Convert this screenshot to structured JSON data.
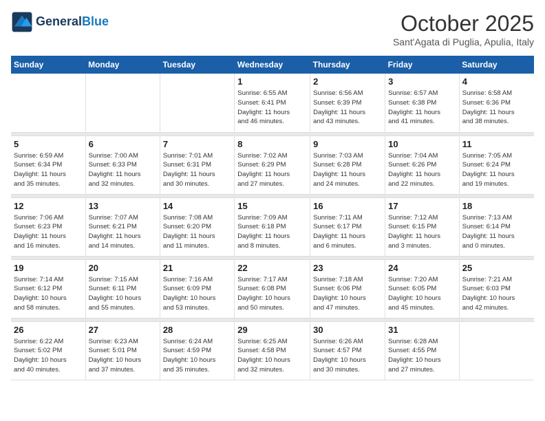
{
  "logo": {
    "line1": "General",
    "line2": "Blue"
  },
  "title": "October 2025",
  "location": "Sant'Agata di Puglia, Apulia, Italy",
  "days_of_week": [
    "Sunday",
    "Monday",
    "Tuesday",
    "Wednesday",
    "Thursday",
    "Friday",
    "Saturday"
  ],
  "weeks": [
    [
      {
        "day": "",
        "info": ""
      },
      {
        "day": "",
        "info": ""
      },
      {
        "day": "",
        "info": ""
      },
      {
        "day": "1",
        "info": "Sunrise: 6:55 AM\nSunset: 6:41 PM\nDaylight: 11 hours\nand 46 minutes."
      },
      {
        "day": "2",
        "info": "Sunrise: 6:56 AM\nSunset: 6:39 PM\nDaylight: 11 hours\nand 43 minutes."
      },
      {
        "day": "3",
        "info": "Sunrise: 6:57 AM\nSunset: 6:38 PM\nDaylight: 11 hours\nand 41 minutes."
      },
      {
        "day": "4",
        "info": "Sunrise: 6:58 AM\nSunset: 6:36 PM\nDaylight: 11 hours\nand 38 minutes."
      }
    ],
    [
      {
        "day": "5",
        "info": "Sunrise: 6:59 AM\nSunset: 6:34 PM\nDaylight: 11 hours\nand 35 minutes."
      },
      {
        "day": "6",
        "info": "Sunrise: 7:00 AM\nSunset: 6:33 PM\nDaylight: 11 hours\nand 32 minutes."
      },
      {
        "day": "7",
        "info": "Sunrise: 7:01 AM\nSunset: 6:31 PM\nDaylight: 11 hours\nand 30 minutes."
      },
      {
        "day": "8",
        "info": "Sunrise: 7:02 AM\nSunset: 6:29 PM\nDaylight: 11 hours\nand 27 minutes."
      },
      {
        "day": "9",
        "info": "Sunrise: 7:03 AM\nSunset: 6:28 PM\nDaylight: 11 hours\nand 24 minutes."
      },
      {
        "day": "10",
        "info": "Sunrise: 7:04 AM\nSunset: 6:26 PM\nDaylight: 11 hours\nand 22 minutes."
      },
      {
        "day": "11",
        "info": "Sunrise: 7:05 AM\nSunset: 6:24 PM\nDaylight: 11 hours\nand 19 minutes."
      }
    ],
    [
      {
        "day": "12",
        "info": "Sunrise: 7:06 AM\nSunset: 6:23 PM\nDaylight: 11 hours\nand 16 minutes."
      },
      {
        "day": "13",
        "info": "Sunrise: 7:07 AM\nSunset: 6:21 PM\nDaylight: 11 hours\nand 14 minutes."
      },
      {
        "day": "14",
        "info": "Sunrise: 7:08 AM\nSunset: 6:20 PM\nDaylight: 11 hours\nand 11 minutes."
      },
      {
        "day": "15",
        "info": "Sunrise: 7:09 AM\nSunset: 6:18 PM\nDaylight: 11 hours\nand 8 minutes."
      },
      {
        "day": "16",
        "info": "Sunrise: 7:11 AM\nSunset: 6:17 PM\nDaylight: 11 hours\nand 6 minutes."
      },
      {
        "day": "17",
        "info": "Sunrise: 7:12 AM\nSunset: 6:15 PM\nDaylight: 11 hours\nand 3 minutes."
      },
      {
        "day": "18",
        "info": "Sunrise: 7:13 AM\nSunset: 6:14 PM\nDaylight: 11 hours\nand 0 minutes."
      }
    ],
    [
      {
        "day": "19",
        "info": "Sunrise: 7:14 AM\nSunset: 6:12 PM\nDaylight: 10 hours\nand 58 minutes."
      },
      {
        "day": "20",
        "info": "Sunrise: 7:15 AM\nSunset: 6:11 PM\nDaylight: 10 hours\nand 55 minutes."
      },
      {
        "day": "21",
        "info": "Sunrise: 7:16 AM\nSunset: 6:09 PM\nDaylight: 10 hours\nand 53 minutes."
      },
      {
        "day": "22",
        "info": "Sunrise: 7:17 AM\nSunset: 6:08 PM\nDaylight: 10 hours\nand 50 minutes."
      },
      {
        "day": "23",
        "info": "Sunrise: 7:18 AM\nSunset: 6:06 PM\nDaylight: 10 hours\nand 47 minutes."
      },
      {
        "day": "24",
        "info": "Sunrise: 7:20 AM\nSunset: 6:05 PM\nDaylight: 10 hours\nand 45 minutes."
      },
      {
        "day": "25",
        "info": "Sunrise: 7:21 AM\nSunset: 6:03 PM\nDaylight: 10 hours\nand 42 minutes."
      }
    ],
    [
      {
        "day": "26",
        "info": "Sunrise: 6:22 AM\nSunset: 5:02 PM\nDaylight: 10 hours\nand 40 minutes."
      },
      {
        "day": "27",
        "info": "Sunrise: 6:23 AM\nSunset: 5:01 PM\nDaylight: 10 hours\nand 37 minutes."
      },
      {
        "day": "28",
        "info": "Sunrise: 6:24 AM\nSunset: 4:59 PM\nDaylight: 10 hours\nand 35 minutes."
      },
      {
        "day": "29",
        "info": "Sunrise: 6:25 AM\nSunset: 4:58 PM\nDaylight: 10 hours\nand 32 minutes."
      },
      {
        "day": "30",
        "info": "Sunrise: 6:26 AM\nSunset: 4:57 PM\nDaylight: 10 hours\nand 30 minutes."
      },
      {
        "day": "31",
        "info": "Sunrise: 6:28 AM\nSunset: 4:55 PM\nDaylight: 10 hours\nand 27 minutes."
      },
      {
        "day": "",
        "info": ""
      }
    ]
  ]
}
